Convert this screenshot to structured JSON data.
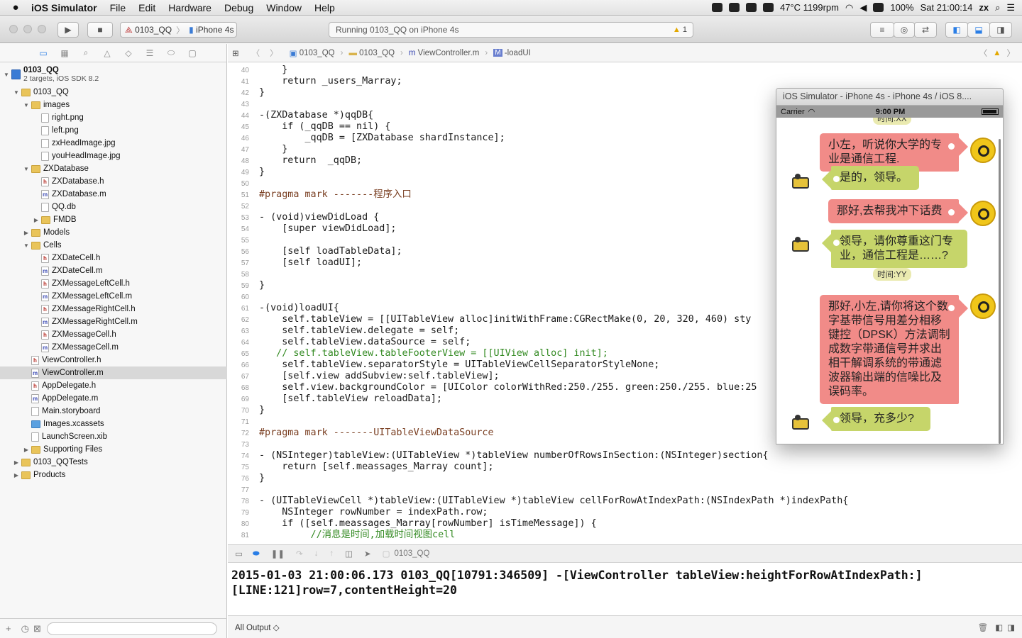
{
  "menubar": {
    "apple": "",
    "app_name": "iOS Simulator",
    "items": [
      "File",
      "Edit",
      "Hardware",
      "Debug",
      "Window",
      "Help"
    ],
    "status": {
      "temp": "47°C 1199rpm",
      "battery": "100%",
      "clock": "Sat 21:00:14",
      "user": "zx"
    }
  },
  "toolbar": {
    "scheme": "0103_QQ",
    "device": "iPhone 4s",
    "activity": "Running 0103_QQ on iPhone 4s",
    "warnings": "1"
  },
  "navigator": {
    "project": "0103_QQ",
    "project_sub": "2 targets, iOS SDK 8.2",
    "items": [
      {
        "label": "0103_QQ",
        "kind": "folder"
      },
      {
        "label": "images",
        "kind": "folder"
      },
      {
        "label": "right.png",
        "kind": "file"
      },
      {
        "label": "left.png",
        "kind": "file"
      },
      {
        "label": "zxHeadImage.jpg",
        "kind": "file"
      },
      {
        "label": "youHeadImage.jpg",
        "kind": "file"
      },
      {
        "label": "ZXDatabase",
        "kind": "folder"
      },
      {
        "label": "ZXDatabase.h",
        "kind": "h"
      },
      {
        "label": "ZXDatabase.m",
        "kind": "m"
      },
      {
        "label": "QQ.db",
        "kind": "file"
      },
      {
        "label": "FMDB",
        "kind": "folder"
      },
      {
        "label": "Models",
        "kind": "folder"
      },
      {
        "label": "Cells",
        "kind": "folder"
      },
      {
        "label": "ZXDateCell.h",
        "kind": "h"
      },
      {
        "label": "ZXDateCell.m",
        "kind": "m"
      },
      {
        "label": "ZXMessageLeftCell.h",
        "kind": "h"
      },
      {
        "label": "ZXMessageLeftCell.m",
        "kind": "m"
      },
      {
        "label": "ZXMessageRightCell.h",
        "kind": "h"
      },
      {
        "label": "ZXMessageRightCell.m",
        "kind": "m"
      },
      {
        "label": "ZXMessageCell.h",
        "kind": "h"
      },
      {
        "label": "ZXMessageCell.m",
        "kind": "m"
      },
      {
        "label": "ViewController.h",
        "kind": "h"
      },
      {
        "label": "ViewController.m",
        "kind": "m"
      },
      {
        "label": "AppDelegate.h",
        "kind": "h"
      },
      {
        "label": "AppDelegate.m",
        "kind": "m"
      },
      {
        "label": "Main.storyboard",
        "kind": "file"
      },
      {
        "label": "Images.xcassets",
        "kind": "asset"
      },
      {
        "label": "LaunchScreen.xib",
        "kind": "file"
      },
      {
        "label": "Supporting Files",
        "kind": "folder"
      },
      {
        "label": "0103_QQTests",
        "kind": "folder"
      },
      {
        "label": "Products",
        "kind": "folder"
      }
    ]
  },
  "jumpbar": {
    "crumbs": [
      "0103_QQ",
      "0103_QQ",
      "ViewController.m",
      "-loadUI"
    ]
  },
  "editor": {
    "lines": [
      {
        "n": "40",
        "t": "    }"
      },
      {
        "n": "41",
        "t": "    return _users_Marray;"
      },
      {
        "n": "42",
        "t": "}"
      },
      {
        "n": "43",
        "t": ""
      },
      {
        "n": "44",
        "t": "-(ZXDatabase *)qqDB{"
      },
      {
        "n": "45",
        "t": "    if (_qqDB == nil) {"
      },
      {
        "n": "46",
        "t": "        _qqDB = [ZXDatabase shardInstance];"
      },
      {
        "n": "47",
        "t": "    }"
      },
      {
        "n": "48",
        "t": "    return  _qqDB;"
      },
      {
        "n": "49",
        "t": "}"
      },
      {
        "n": "50",
        "t": ""
      },
      {
        "n": "51",
        "t": "#pragma mark -------程序入口"
      },
      {
        "n": "52",
        "t": ""
      },
      {
        "n": "53",
        "t": "- (void)viewDidLoad {"
      },
      {
        "n": "54",
        "t": "    [super viewDidLoad];"
      },
      {
        "n": "55",
        "t": ""
      },
      {
        "n": "56",
        "t": "    [self loadTableData];"
      },
      {
        "n": "57",
        "t": "    [self loadUI];"
      },
      {
        "n": "58",
        "t": ""
      },
      {
        "n": "59",
        "t": "}"
      },
      {
        "n": "60",
        "t": ""
      },
      {
        "n": "61",
        "t": "-(void)loadUI{"
      },
      {
        "n": "62",
        "t": "    self.tableView = [[UITableView alloc]initWithFrame:CGRectMake(0, 20, 320, 460) sty"
      },
      {
        "n": "63",
        "t": "    self.tableView.delegate = self;"
      },
      {
        "n": "64",
        "t": "    self.tableView.dataSource = self;"
      },
      {
        "n": "65",
        "t": "   // self.tableView.tableFooterView = [[UIView alloc] init];"
      },
      {
        "n": "66",
        "t": "    self.tableView.separatorStyle = UITableViewCellSeparatorStyleNone;"
      },
      {
        "n": "67",
        "t": "    [self.view addSubview:self.tableView];"
      },
      {
        "n": "68",
        "t": "    self.view.backgroundColor = [UIColor colorWithRed:250./255. green:250./255. blue:25"
      },
      {
        "n": "69",
        "t": "    [self.tableView reloadData];"
      },
      {
        "n": "70",
        "t": "}"
      },
      {
        "n": "71",
        "t": ""
      },
      {
        "n": "72",
        "t": "#pragma mark -------UITableViewDataSource"
      },
      {
        "n": "73",
        "t": ""
      },
      {
        "n": "74",
        "t": "- (NSInteger)tableView:(UITableView *)tableView numberOfRowsInSection:(NSInteger)section{"
      },
      {
        "n": "75",
        "t": "    return [self.meassages_Marray count];"
      },
      {
        "n": "76",
        "t": "}"
      },
      {
        "n": "77",
        "t": ""
      },
      {
        "n": "78",
        "t": "- (UITableViewCell *)tableView:(UITableView *)tableView cellForRowAtIndexPath:(NSIndexPath *)indexPath{"
      },
      {
        "n": "79",
        "t": "    NSInteger rowNumber = indexPath.row;"
      },
      {
        "n": "80",
        "t": "    if ([self.meassages_Marray[rowNumber] isTimeMessage]) {"
      },
      {
        "n": "81",
        "t": "         //消息是时间,加载时间视图cell"
      }
    ]
  },
  "debugbar": {
    "target": "0103_QQ"
  },
  "console": {
    "output": "2015-01-03 21:00:06.173 0103_QQ[10791:346509] -[ViewController tableView:heightForRowAtIndexPath:]\n[LINE:121]row=7,contentHeight=20",
    "filter": "All Output ◇"
  },
  "simulator": {
    "title": "iOS Simulator - iPhone 4s - iPhone 4s / iOS 8....",
    "carrier": "Carrier",
    "time": "9:00 PM",
    "top_badge": "时间:XX",
    "mid_badge": "时间:YY",
    "messages": [
      {
        "side": "right",
        "text": "小左，听说你大学的专业是通信工程."
      },
      {
        "side": "left",
        "text": "是的，领导。"
      },
      {
        "side": "right",
        "text": "那好,去帮我冲下话费"
      },
      {
        "side": "left",
        "text": "领导，请你尊重这门专业，通信工程是……?"
      },
      {
        "side": "right",
        "text": "那好,小左,请你将这个数字基带信号用差分相移键控（DPSK）方法调制成数字带通信号并求出相干解调系统的带通滤波器输出端的信噪比及误码率。"
      },
      {
        "side": "left",
        "text": "领导，充多少?"
      }
    ]
  },
  "colors": {
    "bubble_right": "#f18b88",
    "bubble_left": "#c6d56a",
    "selection": "#d8d8d8"
  }
}
